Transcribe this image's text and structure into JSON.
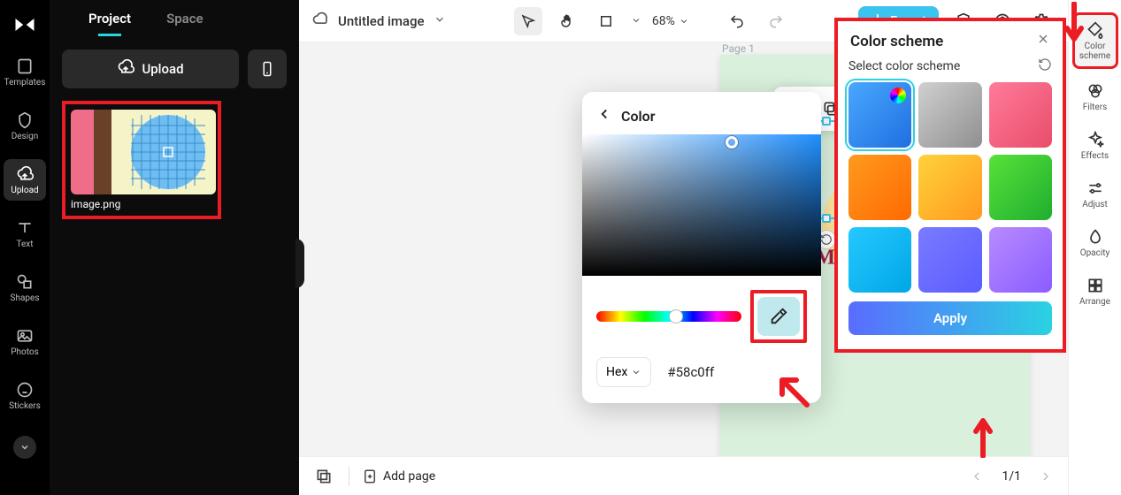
{
  "rail": {
    "items": [
      {
        "label": "Templates"
      },
      {
        "label": "Design"
      },
      {
        "label": "Upload"
      },
      {
        "label": "Text"
      },
      {
        "label": "Shapes"
      },
      {
        "label": "Photos"
      },
      {
        "label": "Stickers"
      }
    ]
  },
  "side": {
    "tabs": {
      "project": "Project",
      "space": "Space"
    },
    "upload_label": "Upload",
    "thumb_name": "image.png"
  },
  "topbar": {
    "title": "Untitled image",
    "zoom": "68%",
    "export": "Export"
  },
  "canvas": {
    "page_label": "Page 1",
    "art_text": "Mocha Madr"
  },
  "color_popover": {
    "title": "Color",
    "mode": "Hex",
    "hex": "#58c0ff"
  },
  "scheme_panel": {
    "title": "Color scheme",
    "subtitle": "Select color scheme",
    "apply": "Apply",
    "swatches": [
      "linear-gradient(135deg,#4aa8ff,#1f6fe0)",
      "linear-gradient(135deg,#d0d0d0,#8f8f8f)",
      "linear-gradient(135deg,#ff7b9a,#e94d6b)",
      "linear-gradient(135deg,#ff9a1f,#ff6a00)",
      "linear-gradient(135deg,#ffd23a,#ff9a1f)",
      "linear-gradient(135deg,#58e23a,#1fae2f)",
      "linear-gradient(135deg,#25c8ff,#00a6e6)",
      "linear-gradient(135deg,#7a7bff,#5a5cff)",
      "linear-gradient(135deg,#b88bff,#8a5cff)"
    ]
  },
  "rrail": {
    "items": [
      {
        "label": "Color scheme"
      },
      {
        "label": "Filters"
      },
      {
        "label": "Effects"
      },
      {
        "label": "Adjust"
      },
      {
        "label": "Opacity"
      },
      {
        "label": "Arrange"
      }
    ]
  },
  "bottombar": {
    "add_page": "Add page",
    "page": "1/1"
  }
}
